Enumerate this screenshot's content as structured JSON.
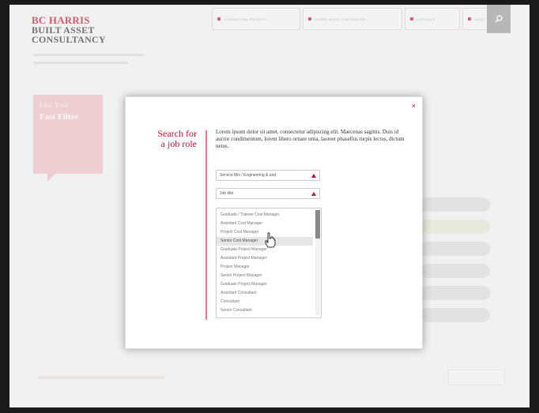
{
  "logo": {
    "line1": "BC HARRIS",
    "line2": "BUILT ASSET",
    "line3": "CONSULTANCY"
  },
  "nav": {
    "items": [
      {
        "label": "INTERNATIONAL PROJECTS"
      },
      {
        "label": "CAREER ADVICE & INFORMATION"
      },
      {
        "label": "LIVE ROLES"
      },
      {
        "label": "ABOUT"
      }
    ],
    "search_icon": "search-icon"
  },
  "background": {
    "card_line1": "Find Your",
    "card_line2": "Fast Filter"
  },
  "modal": {
    "close": "×",
    "title_line1": "Search for",
    "title_line2": "a job role",
    "description": "Lorem ipsum dolor sit amet, consectetur adipiscing elit. Maecenas sagittis. Duis id auctor condimentum, lorem libero ornare urna, laoreet phasellus turpis lectus, dictum netus.",
    "dropdown1": "Service Mix / Engineering & and",
    "dropdown2": "Job title",
    "list_items": [
      "Graduate / Trainee Cost Manager",
      "Assistant Cost Manager",
      "Project Cost Manager",
      "Senior Cost Manager",
      "Graduate Project Manager",
      "Assistant Project Manager",
      "Project Manager",
      "Senior Project Manager",
      "Graduate Project Manager",
      "Assistant Consultant",
      "Consultant",
      "Senior Consultant"
    ],
    "highlighted_index": 3
  },
  "colors": {
    "brand": "#c8102e",
    "pink": "#f2c2c8"
  }
}
